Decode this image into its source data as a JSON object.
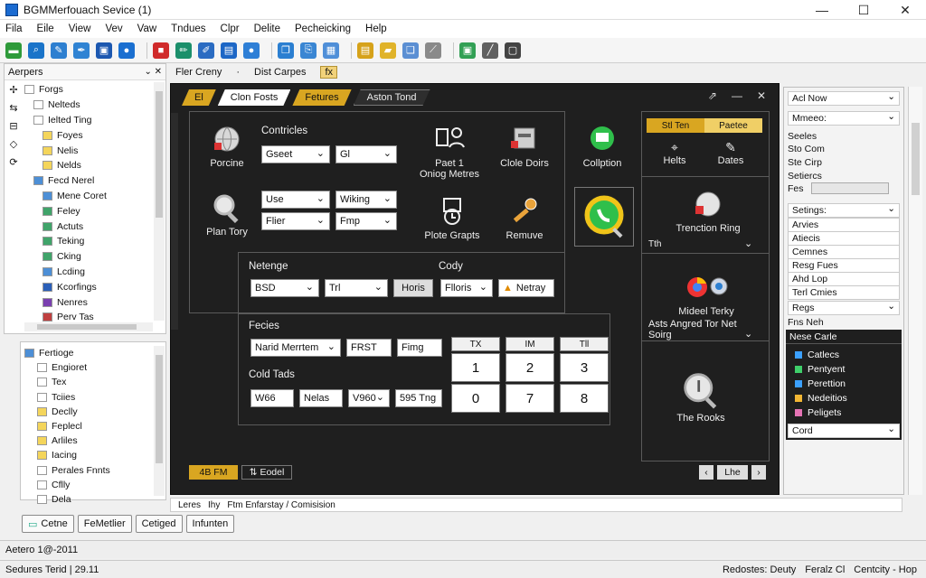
{
  "window": {
    "title": "BGMMerfouach Sevice (1)",
    "controls": [
      "—",
      "☐",
      "✕"
    ]
  },
  "menu": [
    "Fila",
    "Eile",
    "View",
    "Vev",
    "Vaw",
    "Tndues",
    "Clpr",
    "Delite",
    "Pecheicking",
    "Help"
  ],
  "toolbar_icons": [
    {
      "name": "new-icon",
      "color": "#2e9a3a",
      "glyph": "▬"
    },
    {
      "name": "search-icon",
      "color": "#1a74c9",
      "glyph": "⌕"
    },
    {
      "name": "edit-icon",
      "color": "#2d7fd0",
      "glyph": "✎"
    },
    {
      "name": "pen-icon",
      "color": "#2f83d3",
      "glyph": "✒"
    },
    {
      "name": "save-icon",
      "color": "#1c58b0",
      "glyph": "▣"
    },
    {
      "name": "globe-icon",
      "color": "#1a6fd0",
      "glyph": "●"
    },
    {
      "name": "stop-icon",
      "color": "#d02a2a",
      "glyph": "■"
    },
    {
      "name": "pencil-icon",
      "color": "#1b8f6b",
      "glyph": "✏"
    },
    {
      "name": "brush-icon",
      "color": "#2b6cc2",
      "glyph": "✐"
    },
    {
      "name": "document-icon",
      "color": "#1d67c6",
      "glyph": "▤"
    },
    {
      "name": "circle-icon",
      "color": "#2e7fd6",
      "glyph": "●"
    },
    {
      "name": "copy-icon",
      "color": "#2b7fd1",
      "glyph": "❐"
    },
    {
      "name": "paste-icon",
      "color": "#3a86d3",
      "glyph": "⎘"
    },
    {
      "name": "grid-icon",
      "color": "#4f8fd8",
      "glyph": "▦"
    },
    {
      "name": "note-icon",
      "color": "#d6a21a",
      "glyph": "▤"
    },
    {
      "name": "folder-icon",
      "color": "#e0b32a",
      "glyph": "▰"
    },
    {
      "name": "files-icon",
      "color": "#5b8fd3",
      "glyph": "❑"
    },
    {
      "name": "link-icon",
      "color": "#8a8a8a",
      "glyph": "⟋"
    },
    {
      "name": "image-icon",
      "color": "#32a055",
      "glyph": "▣"
    },
    {
      "name": "line-icon",
      "color": "#606060",
      "glyph": "╱"
    },
    {
      "name": "layout-icon",
      "color": "#444444",
      "glyph": "▢"
    }
  ],
  "left_panel": {
    "header": "Aerpers",
    "header_controls": "⌄ ✕",
    "side_icons": [
      "✢",
      "⇆",
      "⊟",
      "◇",
      "⟳"
    ],
    "tree": [
      {
        "label": "Forgs",
        "indent": 0,
        "color": "#ffffff"
      },
      {
        "label": "Nelteds",
        "indent": 1,
        "color": "#ffffff"
      },
      {
        "label": "Ielted Ting",
        "indent": 1,
        "color": "#ffffff"
      },
      {
        "label": "Foyes",
        "indent": 2,
        "color": "#f4d55b"
      },
      {
        "label": "Nelis",
        "indent": 2,
        "color": "#f4d55b"
      },
      {
        "label": "Nelds",
        "indent": 2,
        "color": "#f4d55b"
      },
      {
        "label": "Fecd Nerel",
        "indent": 1,
        "color": "#4d8fd6"
      },
      {
        "label": "Mene Coret",
        "indent": 2,
        "color": "#4d8fd6"
      },
      {
        "label": "Feley",
        "indent": 2,
        "color": "#40a46a"
      },
      {
        "label": "Actuts",
        "indent": 2,
        "color": "#40a46a"
      },
      {
        "label": "Teking",
        "indent": 2,
        "color": "#40a46a"
      },
      {
        "label": "Cking",
        "indent": 2,
        "color": "#40a46a"
      },
      {
        "label": "Lcding",
        "indent": 2,
        "color": "#4d8fd6"
      },
      {
        "label": "Kcorfings",
        "indent": 2,
        "color": "#2b5fb8"
      },
      {
        "label": "Nenres",
        "indent": 2,
        "color": "#7a3fb0"
      },
      {
        "label": "Perv Tas",
        "indent": 2,
        "color": "#c04040"
      }
    ],
    "lower_header": "Fertioge",
    "lower_tree": [
      {
        "label": "Fertioge",
        "color": "#4d8fd6"
      },
      {
        "label": "Engioret",
        "color": "#ffffff"
      },
      {
        "label": "Tex",
        "color": "#ffffff"
      },
      {
        "label": "Tciies",
        "color": "#ffffff"
      },
      {
        "label": "Declly",
        "color": "#f4d55b"
      },
      {
        "label": "Feplecl",
        "color": "#f4d55b"
      },
      {
        "label": "Arliles",
        "color": "#f4d55b"
      },
      {
        "label": "Iacing",
        "color": "#f4d55b"
      },
      {
        "label": "Perales Fnnts",
        "color": "#ffffff"
      },
      {
        "label": "Cflly",
        "color": "#ffffff"
      },
      {
        "label": "Dela",
        "color": "#ffffff"
      }
    ]
  },
  "crumbs": {
    "first": "Fler Creny",
    "second": "Dist Carpes",
    "badge": "fx"
  },
  "main": {
    "tabs": [
      {
        "label": "El",
        "style": "gold"
      },
      {
        "label": "Clon Fosts",
        "style": "white"
      },
      {
        "label": "Fetures",
        "style": "gold"
      },
      {
        "label": "Aston Tond",
        "style": "dark"
      }
    ],
    "controls": [
      "⇗",
      "—",
      "✕"
    ],
    "contricles_label": "Contricles",
    "porcine": "Porcine",
    "plan_tory": "Plan Tory",
    "select1": "Gseet",
    "select2": "Gl",
    "select3": "Use",
    "select4": "Wiking",
    "select5": "Flier",
    "select6": "Fmp",
    "tools": {
      "paste": "Paet 1\nOniog Metres",
      "paste_l1": "Paet 1",
      "paste_l2": "Oniog Metres",
      "cloud": "Clole Doirs",
      "plot": "Plote Grapts",
      "remove": "Remuve",
      "collption": "Collption"
    },
    "netenge": {
      "label": "Netenge",
      "cody": "Cody",
      "f1": "BSD",
      "f2": "Trl",
      "btn": "Horis",
      "f3": "Flloris",
      "warn": "Netray"
    },
    "fecies": {
      "label": "Fecies",
      "f1": "Narid Merrtem",
      "f2": "FRST",
      "f3": "Fimg",
      "cold": "Cold Tads",
      "g1": "W66",
      "g2": "Nelas",
      "g3": "V960",
      "g4": "595 Tng"
    },
    "grid": {
      "headers": [
        "TX",
        "IM",
        "Tll"
      ],
      "row1": [
        "1",
        "2",
        "3"
      ],
      "row2": [
        "0",
        "7",
        "8"
      ]
    },
    "right_col": {
      "tab1": "Stl Ten",
      "tab2": "Paetee",
      "i1": "Helts",
      "i2": "Dates",
      "trenction": "Trenction Ring",
      "trenction_sub": "Tth",
      "mided": "Mideel Terky",
      "asts": "Asts Angred  Tor Net",
      "asts_sub": "Soirg",
      "rooks": "The Rooks"
    },
    "bottom_left": "4B FM",
    "bottom_left2": "Eodel",
    "bottom_right": "Lhe"
  },
  "right_panel": {
    "items_top": [
      "Acl Now",
      "Mmeeo:",
      "Seeles",
      "Sto Com",
      "Ste Cirp",
      "Setiercs",
      "Fes"
    ],
    "items_mid": [
      "Setings:",
      "Arvies",
      "Atiecis",
      "Cemnes",
      "Resg Fues",
      "Ahd Lop",
      "Terl Cmies",
      "Regs",
      "Fns Neh"
    ],
    "dark_header": "Nese Carle",
    "list": [
      {
        "label": "Catlecs",
        "color": "#3ba0ff"
      },
      {
        "label": "Pentyent",
        "color": "#3fcf6a"
      },
      {
        "label": "Perettion",
        "color": "#3ba0ff"
      },
      {
        "label": "Nedeitios",
        "color": "#f2b634"
      },
      {
        "label": "Peligets",
        "color": "#e573b4"
      }
    ],
    "cord": "Cord"
  },
  "tabline": [
    "Leres",
    "Ihy",
    "Ftm Enfarstay / Comisision"
  ],
  "bottom_buttons": [
    "Cetne",
    "FeMetlier",
    "Cetiged",
    "Infunten"
  ],
  "status_top": "Aetero 1@-2011",
  "status_bottom_left": "Sedures Terid   | 29.11",
  "status_bottom_right": [
    "Redostes: Deuty",
    "Feralz Cl",
    "Centcity - Hop"
  ]
}
